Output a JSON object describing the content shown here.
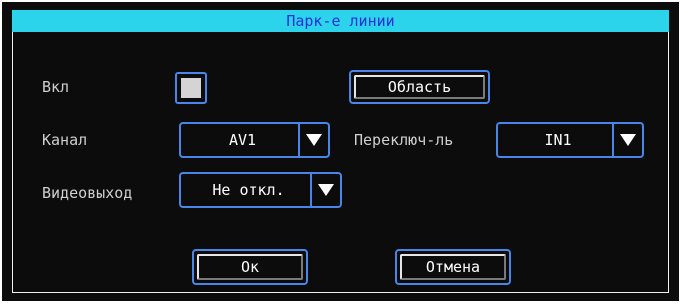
{
  "dialog": {
    "title": "Парк-е линии"
  },
  "enable": {
    "label": "Вкл",
    "checked": false
  },
  "area_button": {
    "label": "Область"
  },
  "channel": {
    "label": "Канал",
    "value": "AV1"
  },
  "switch": {
    "label": "Переключ-ль",
    "value": "IN1"
  },
  "video_out": {
    "label": "Видеовыход",
    "value": "Не откл."
  },
  "footer": {
    "ok_label": "Ок",
    "cancel_label": "Отмена"
  },
  "colors": {
    "title_bg": "#2bd4ea",
    "title_text": "#2a2fd8",
    "panel_bg": "#0c0c0c",
    "accent_border": "#4a86e8"
  }
}
